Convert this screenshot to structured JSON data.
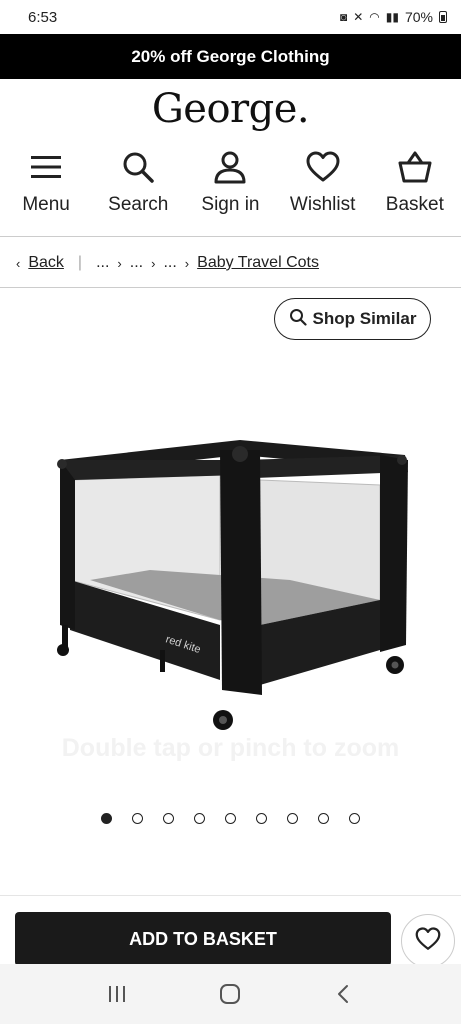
{
  "status_bar": {
    "time": "6:53",
    "battery": "70%"
  },
  "promo": {
    "text": "20% off George Clothing"
  },
  "brand": {
    "logo": "George."
  },
  "nav": [
    {
      "label": "Menu",
      "icon": "menu-icon"
    },
    {
      "label": "Search",
      "icon": "search-icon"
    },
    {
      "label": "Sign in",
      "icon": "user-icon"
    },
    {
      "label": "Wishlist",
      "icon": "heart-icon"
    },
    {
      "label": "Basket",
      "icon": "basket-icon"
    }
  ],
  "breadcrumb": {
    "back_label": "Back",
    "collapsed": [
      "...",
      "...",
      "..."
    ],
    "current": "Baby Travel Cots"
  },
  "shop_similar": {
    "label": "Shop Similar"
  },
  "product": {
    "brand_mark": "red kite",
    "zoom_hint": "Double tap or pinch to zoom"
  },
  "carousel": {
    "total": 9,
    "active": 0
  },
  "actions": {
    "add_to_basket": "ADD TO BASKET"
  },
  "colors": {
    "promo_bg": "#000000",
    "button_bg": "#1a1a1a"
  }
}
